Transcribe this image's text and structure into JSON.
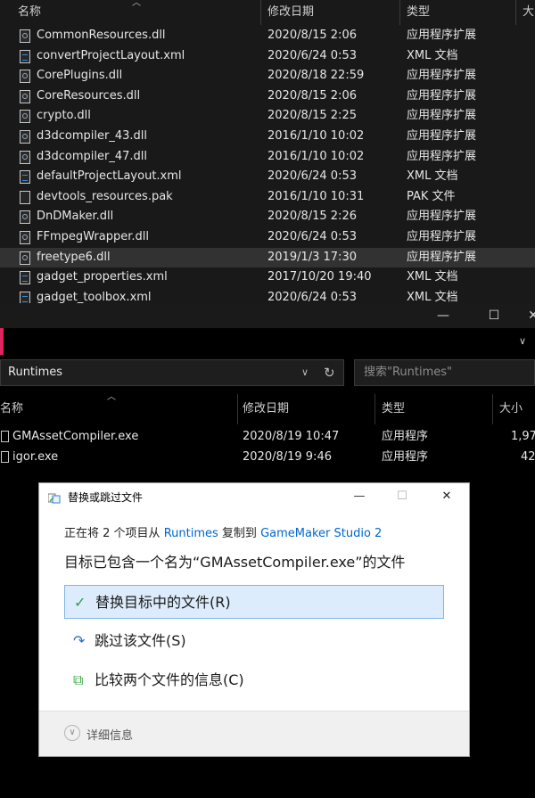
{
  "top_window": {
    "columns": {
      "name": "名称",
      "date": "修改日期",
      "type": "类型",
      "size": "大"
    },
    "files": [
      {
        "name": "CommonResources.dll",
        "date": "2020/8/15 2:06",
        "type": "应用程序扩展",
        "icon": "dll"
      },
      {
        "name": "convertProjectLayout.xml",
        "date": "2020/6/24 0:53",
        "type": "XML 文档",
        "icon": "xml"
      },
      {
        "name": "CorePlugins.dll",
        "date": "2020/8/18 22:59",
        "type": "应用程序扩展",
        "icon": "dll"
      },
      {
        "name": "CoreResources.dll",
        "date": "2020/8/15 2:06",
        "type": "应用程序扩展",
        "icon": "dll"
      },
      {
        "name": "crypto.dll",
        "date": "2020/8/15 2:25",
        "type": "应用程序扩展",
        "icon": "dll"
      },
      {
        "name": "d3dcompiler_43.dll",
        "date": "2016/1/10 10:02",
        "type": "应用程序扩展",
        "icon": "dll"
      },
      {
        "name": "d3dcompiler_47.dll",
        "date": "2016/1/10 10:02",
        "type": "应用程序扩展",
        "icon": "dll"
      },
      {
        "name": "defaultProjectLayout.xml",
        "date": "2020/6/24 0:53",
        "type": "XML 文档",
        "icon": "xml"
      },
      {
        "name": "devtools_resources.pak",
        "date": "2016/1/10 10:31",
        "type": "PAK 文件",
        "icon": "pak"
      },
      {
        "name": "DnDMaker.dll",
        "date": "2020/8/15 2:26",
        "type": "应用程序扩展",
        "icon": "dll"
      },
      {
        "name": "FFmpegWrapper.dll",
        "date": "2020/6/24 0:53",
        "type": "应用程序扩展",
        "icon": "dll"
      },
      {
        "name": "freetype6.dll",
        "date": "2019/1/3 17:30",
        "type": "应用程序扩展",
        "icon": "dll",
        "selected": true
      },
      {
        "name": "gadget_properties.xml",
        "date": "2017/10/20 19:40",
        "type": "XML 文档",
        "icon": "xml"
      },
      {
        "name": "gadget_toolbox.xml",
        "date": "2020/6/24 0:53",
        "type": "XML 文档",
        "icon": "xml"
      }
    ]
  },
  "bottom_window": {
    "titlebar": {
      "minimize": "—",
      "maximize": "☐",
      "close": "✕"
    },
    "address": "Runtimes",
    "search_placeholder": "搜索\"Runtimes\"",
    "columns": {
      "name": "名称",
      "date": "修改日期",
      "type": "类型",
      "size": "大小"
    },
    "files": [
      {
        "name": "GMAssetCompiler.exe",
        "date": "2020/8/19 10:47",
        "type": "应用程序",
        "size": "1,97"
      },
      {
        "name": "igor.exe",
        "date": "2020/8/19 9:46",
        "type": "应用程序",
        "size": "42"
      }
    ]
  },
  "dialog": {
    "title": "替换或跳过文件",
    "progress_prefix": "正在将 2 个项目从",
    "source": "Runtimes",
    "copy_to": "复制到",
    "destination": "GameMaker Studio 2",
    "message": "目标已包含一个名为“GMAssetCompiler.exe”的文件",
    "options": {
      "replace": "替换目标中的文件(R)",
      "skip": "跳过该文件(S)",
      "compare": "比较两个文件的信息(C)"
    },
    "details": "详细信息",
    "controls": {
      "minimize": "—",
      "maximize": "☐",
      "close": "✕"
    },
    "accent": "#0066cc"
  }
}
